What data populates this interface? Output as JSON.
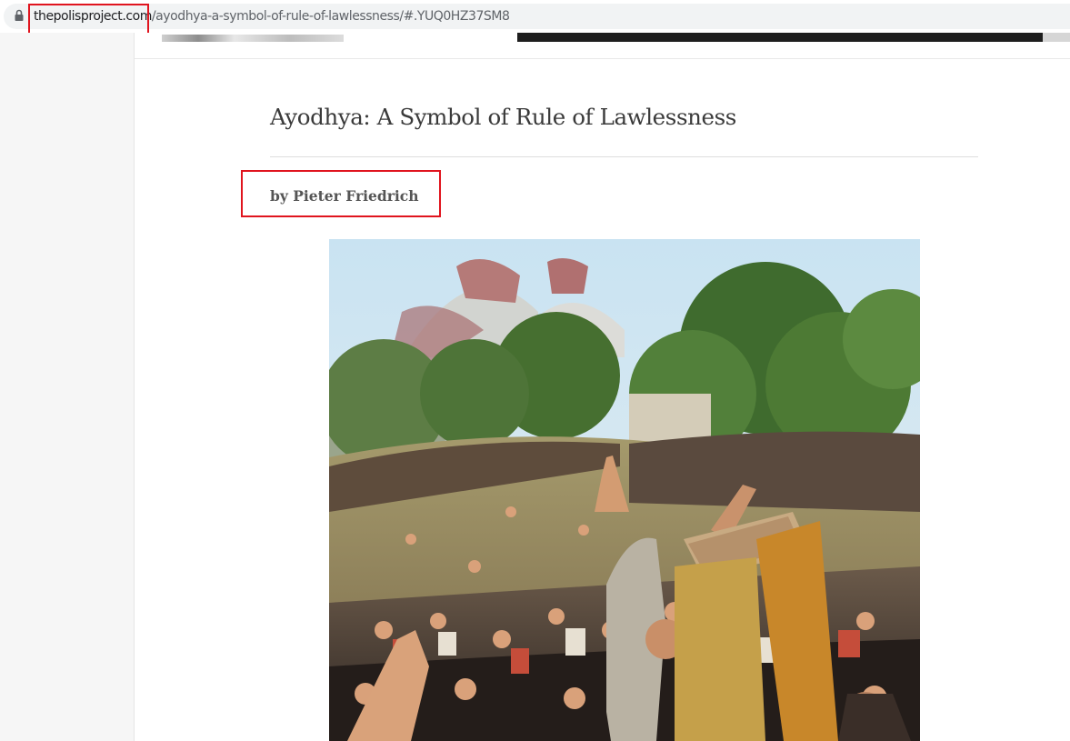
{
  "browser": {
    "url_domain": "thepolisproject.com",
    "url_path": "/ayodhya-a-symbol-of-rule-of-lawlessness/#.YUQ0HZ37SM8",
    "lock_icon": "lock-icon"
  },
  "article": {
    "title": "Ayodhya: A Symbol of Rule of Lawlessness",
    "byline": "by Pieter Friedrich"
  },
  "colors": {
    "highlight": "#e0141e",
    "title_text": "#3a3a3a",
    "byline_text": "#555555"
  }
}
